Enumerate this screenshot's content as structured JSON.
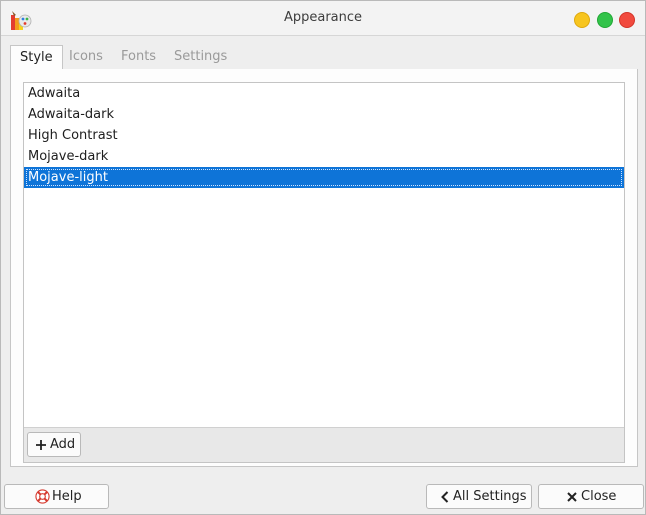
{
  "window": {
    "title": "Appearance"
  },
  "tabs": [
    {
      "label": "Style",
      "active": true
    },
    {
      "label": "Icons",
      "active": false
    },
    {
      "label": "Fonts",
      "active": false
    },
    {
      "label": "Settings",
      "active": false
    }
  ],
  "style_list": {
    "items": [
      {
        "label": "Adwaita",
        "selected": false
      },
      {
        "label": "Adwaita-dark",
        "selected": false
      },
      {
        "label": "High Contrast",
        "selected": false
      },
      {
        "label": "Mojave-dark",
        "selected": false
      },
      {
        "label": "Mojave-light",
        "selected": true
      }
    ],
    "add_label": "Add",
    "add_icon": "plus-icon"
  },
  "footer": {
    "help_label": "Help",
    "help_icon": "lifebuoy-icon",
    "all_settings_label": "All Settings",
    "all_settings_icon": "chevron-left-icon",
    "close_label": "Close",
    "close_icon": "x-icon"
  },
  "colors": {
    "selection": "#0e74d8",
    "minimize": "#f7c51f",
    "maximize": "#32c34a",
    "close": "#f14a3e"
  }
}
